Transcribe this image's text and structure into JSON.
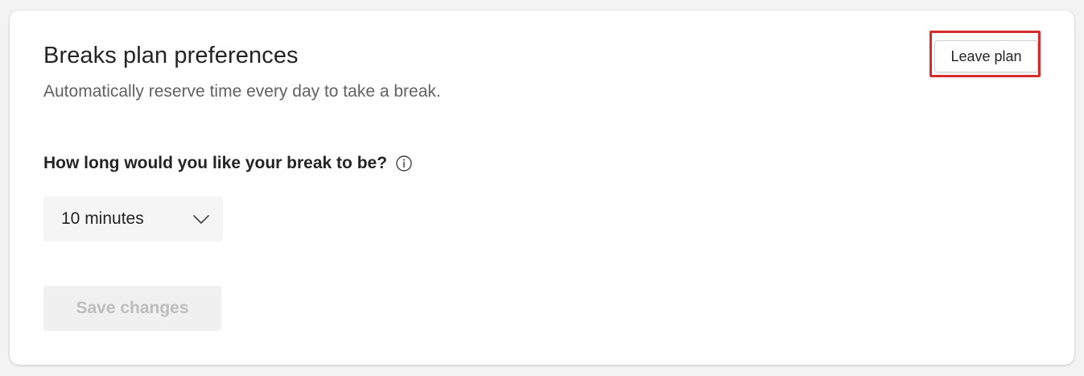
{
  "header": {
    "title": "Breaks plan preferences",
    "subtitle": "Automatically reserve time every day to take a break.",
    "leave_plan_label": "Leave plan"
  },
  "break_length": {
    "question": "How long would you like your break to be?",
    "selected_value": "10 minutes",
    "info_icon": "info-icon",
    "chevron_icon": "chevron-down-icon"
  },
  "actions": {
    "save_label": "Save changes",
    "save_disabled": true
  },
  "colors": {
    "highlight_border": "#d72b2b",
    "text_primary": "#242424",
    "text_secondary": "#616161",
    "disabled_text": "#bdbdbd"
  }
}
